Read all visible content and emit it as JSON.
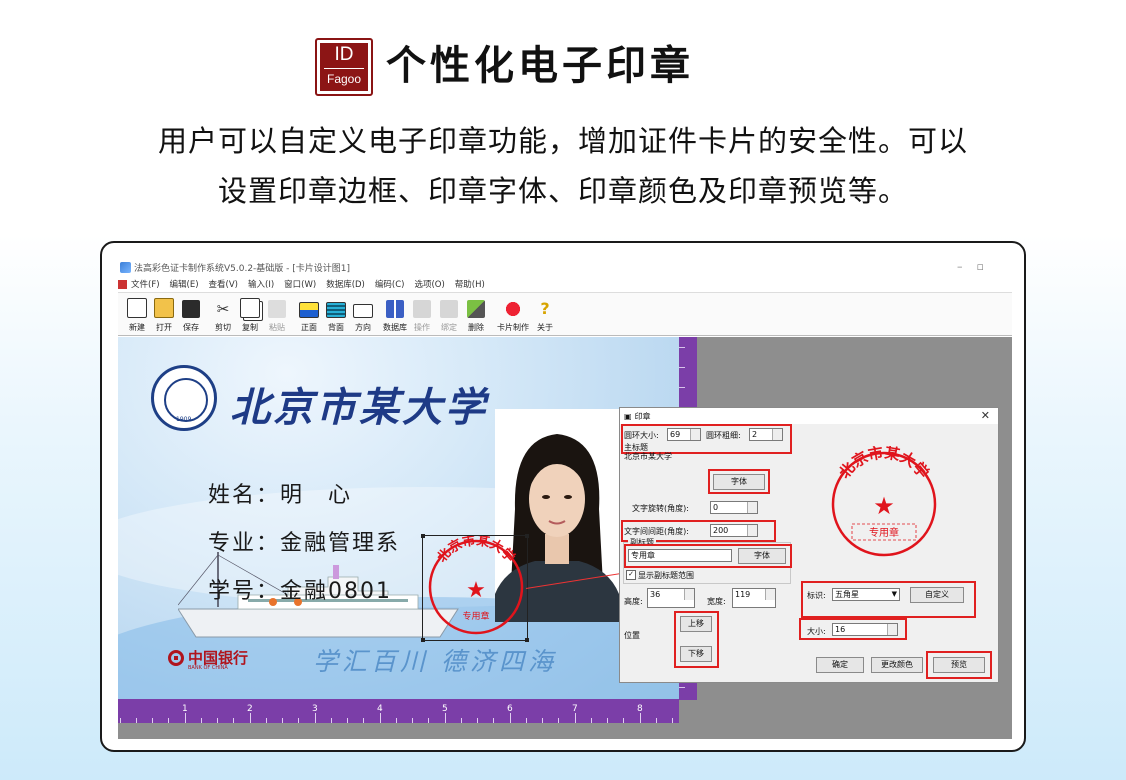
{
  "header": {
    "logo_top": "ID",
    "logo_bottom": "Fagoo",
    "title": "个性化电子印章",
    "subtitle_line1": "用户可以自定义电子印章功能，增加证件卡片的安全性。可以",
    "subtitle_line2": "设置印章边框、印章字体、印章颜色及印章预览等。"
  },
  "app": {
    "window_title": "法高彩色证卡制作系统V5.0.2-基础版 - [卡片设计图1]",
    "menu": [
      "文件(F)",
      "编辑(E)",
      "查看(V)",
      "输入(I)",
      "窗口(W)",
      "数据库(D)",
      "编码(C)",
      "选项(O)",
      "帮助(H)"
    ],
    "toolbar": [
      {
        "label": "新建",
        "icon": "new-file-icon",
        "enabled": true
      },
      {
        "label": "打开",
        "icon": "open-folder-icon",
        "enabled": true
      },
      {
        "label": "保存",
        "icon": "save-disk-icon",
        "enabled": true
      },
      {
        "label": "剪切",
        "icon": "scissors-icon",
        "enabled": true
      },
      {
        "label": "复制",
        "icon": "copy-icon",
        "enabled": true
      },
      {
        "label": "粘贴",
        "icon": "paste-icon",
        "enabled": false
      },
      {
        "label": "正面",
        "icon": "card-front-icon",
        "enabled": true
      },
      {
        "label": "背面",
        "icon": "card-back-icon",
        "enabled": true
      },
      {
        "label": "方向",
        "icon": "direction-icon",
        "enabled": true
      },
      {
        "label": "数据库",
        "icon": "database-icon",
        "enabled": true
      },
      {
        "label": "操作",
        "icon": "operation-icon",
        "enabled": false
      },
      {
        "label": "绑定",
        "icon": "bind-icon",
        "enabled": false
      },
      {
        "label": "删除",
        "icon": "delete-icon",
        "enabled": true
      },
      {
        "label": "卡片制作",
        "icon": "card-make-icon",
        "enabled": true
      },
      {
        "label": "关于",
        "icon": "about-icon",
        "enabled": true
      }
    ],
    "ruler_numbers": [
      "1",
      "2",
      "3",
      "4",
      "5",
      "6",
      "7",
      "8"
    ]
  },
  "card": {
    "university": "北京市某大学",
    "emblem_year": "1909",
    "name_label": "姓名：",
    "name_value": "明　心",
    "major_label": "专业：",
    "major_value": "金融管理系",
    "id_label": "学号：",
    "id_value": "金融0801",
    "bank": "中国银行",
    "bank_en": "BANK OF CHINA",
    "motto": "学汇百川 德济四海"
  },
  "seal": {
    "main_text": "北京市某大学",
    "sub_text": "专用章",
    "color": "#e0141c"
  },
  "dialog": {
    "title": "印章",
    "ring_size_label": "圆环大小:",
    "ring_size_value": "69",
    "ring_width_label": "圆环粗细:",
    "ring_width_value": "2",
    "main_title_label": "主标题",
    "main_title_value": "北京市某大学",
    "font_button": "字体",
    "rotation_label": "文字旋转(角度):",
    "rotation_value": "0",
    "spacing_label": "文字间间距(角度):",
    "spacing_value": "200",
    "subtitle_label": "副标题",
    "subtitle_value": "专用章",
    "subtitle_font_button": "字体",
    "show_subtitle_label": "显示副标题范围",
    "height_label": "高度:",
    "height_value": "36",
    "width_label": "宽度:",
    "width_value": "119",
    "position_label": "位置",
    "up_button": "上移",
    "down_button": "下移",
    "mark_label": "标识:",
    "mark_value": "五角星",
    "custom_button": "自定义",
    "size_label": "大小:",
    "size_value": "16",
    "ok_button": "确定",
    "color_button": "更改颜色",
    "preview_button": "预览"
  }
}
